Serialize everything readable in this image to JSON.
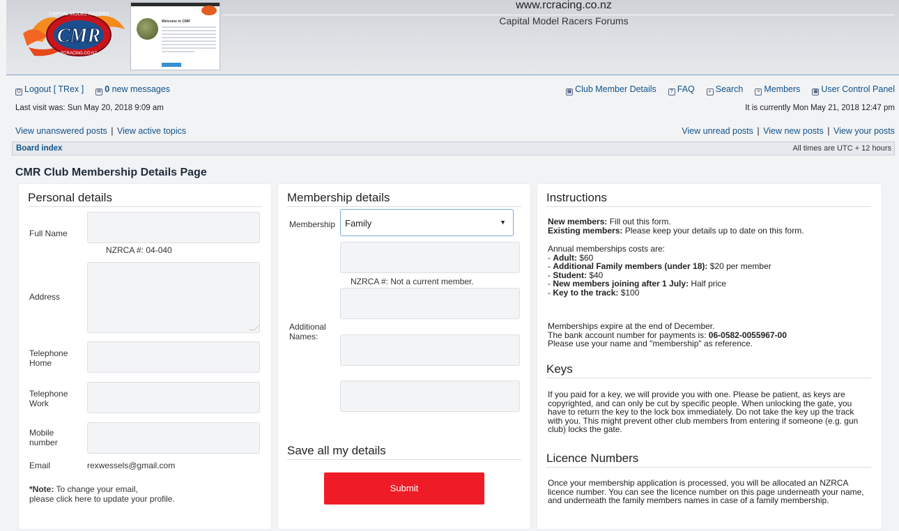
{
  "header": {
    "site_url": "www.rcracing.co.nz",
    "site_description": "Capital Model Racers Forums",
    "logo_text": "CMR",
    "logo_ring_text": "CAPITAL MODEL RACERS",
    "logo_bottom_text": "RCRACING.CO.NZ",
    "thumbnail_title": "Welcome to CMR"
  },
  "nav": {
    "logout": "Logout [ TRex ]",
    "new_messages_count": "0",
    "new_messages_label": "new messages",
    "club_member_details": "Club Member Details",
    "faq": "FAQ",
    "search": "Search",
    "members": "Members",
    "user_control_panel": "User Control Panel",
    "last_visit": "Last visit was: Sun May 20, 2018 9:09 am",
    "current_time": "It is currently Mon May 21, 2018 12:47 pm",
    "view_unanswered": "View unanswered posts",
    "view_active": "View active topics",
    "view_unread": "View unread posts",
    "view_new": "View new posts",
    "view_your": "View your posts",
    "separator": "|"
  },
  "breadcrumb": {
    "board_index": "Board index",
    "timezone": "All times are UTC + 12 hours"
  },
  "page_title": "CMR Club Membership Details Page",
  "personal": {
    "heading": "Personal details",
    "full_name_label": "Full Name",
    "nzrca": "NZRCA #: 04-040",
    "address_label": "Address",
    "tel_home_label": "Telephone Home",
    "tel_work_label": "Telephone Work",
    "mobile_label": "Mobile number",
    "email_label": "Email",
    "email_value": "rexwessels@gmail.com",
    "note_bold": "*Note:",
    "note_text": " To change your email,",
    "note_link": "please click here to update your profile."
  },
  "membership": {
    "heading": "Membership details",
    "membership_label": "Membership",
    "membership_value": "Family",
    "nzrca": "NZRCA #: Not a current member.",
    "additional_names_label": "Additional Names:",
    "save_heading": "Save all my details",
    "submit_label": "Submit"
  },
  "instructions": {
    "heading": "Instructions",
    "new_members_bold": "New members:",
    "new_members_text": " Fill out this form.",
    "existing_members_bold": "Existing members:",
    "existing_members_text": " Please keep your details up to date on this form.",
    "costs_intro": "Annual memberships costs are:",
    "adult_bold": "Adult:",
    "adult_text": " $60",
    "family_bold": "Additional Family members (under 18):",
    "family_text": " $20 per member",
    "student_bold": "Student:",
    "student_text": " $40",
    "new_july_bold": "New members joining after 1 July:",
    "new_july_text": " Half price",
    "key_bold": "Key to the track:",
    "key_text": " $100",
    "expire": "Memberships expire at the end of December.",
    "bank_text": "The bank account number for payments is: ",
    "bank_number": "06-0582-0055967-00",
    "reference": "Please use your name and \"membership\" as reference.",
    "keys_heading": "Keys",
    "keys_text": "If you paid for a key, we will provide you with one. Please be patient, as keys are copyrighted, and can only be cut by specific people. When unlocking the gate, you have to return the key to the lock box immediately. Do not take the key up the track with you. This might prevent other club members from entering if someone (e.g. gun club) locks the gate.",
    "licence_heading": "Licence Numbers",
    "licence_text": "Once your membership application is processed, you will be allocated an NZRCA licence number. You can see the licence number on this page underneath your name, and underneath the family members names in case of a family membership."
  },
  "colors": {
    "link": "#105289",
    "submit": "#ef1c27",
    "page_bg": "#f2f3f5",
    "header_border": "#7d9ec1"
  }
}
